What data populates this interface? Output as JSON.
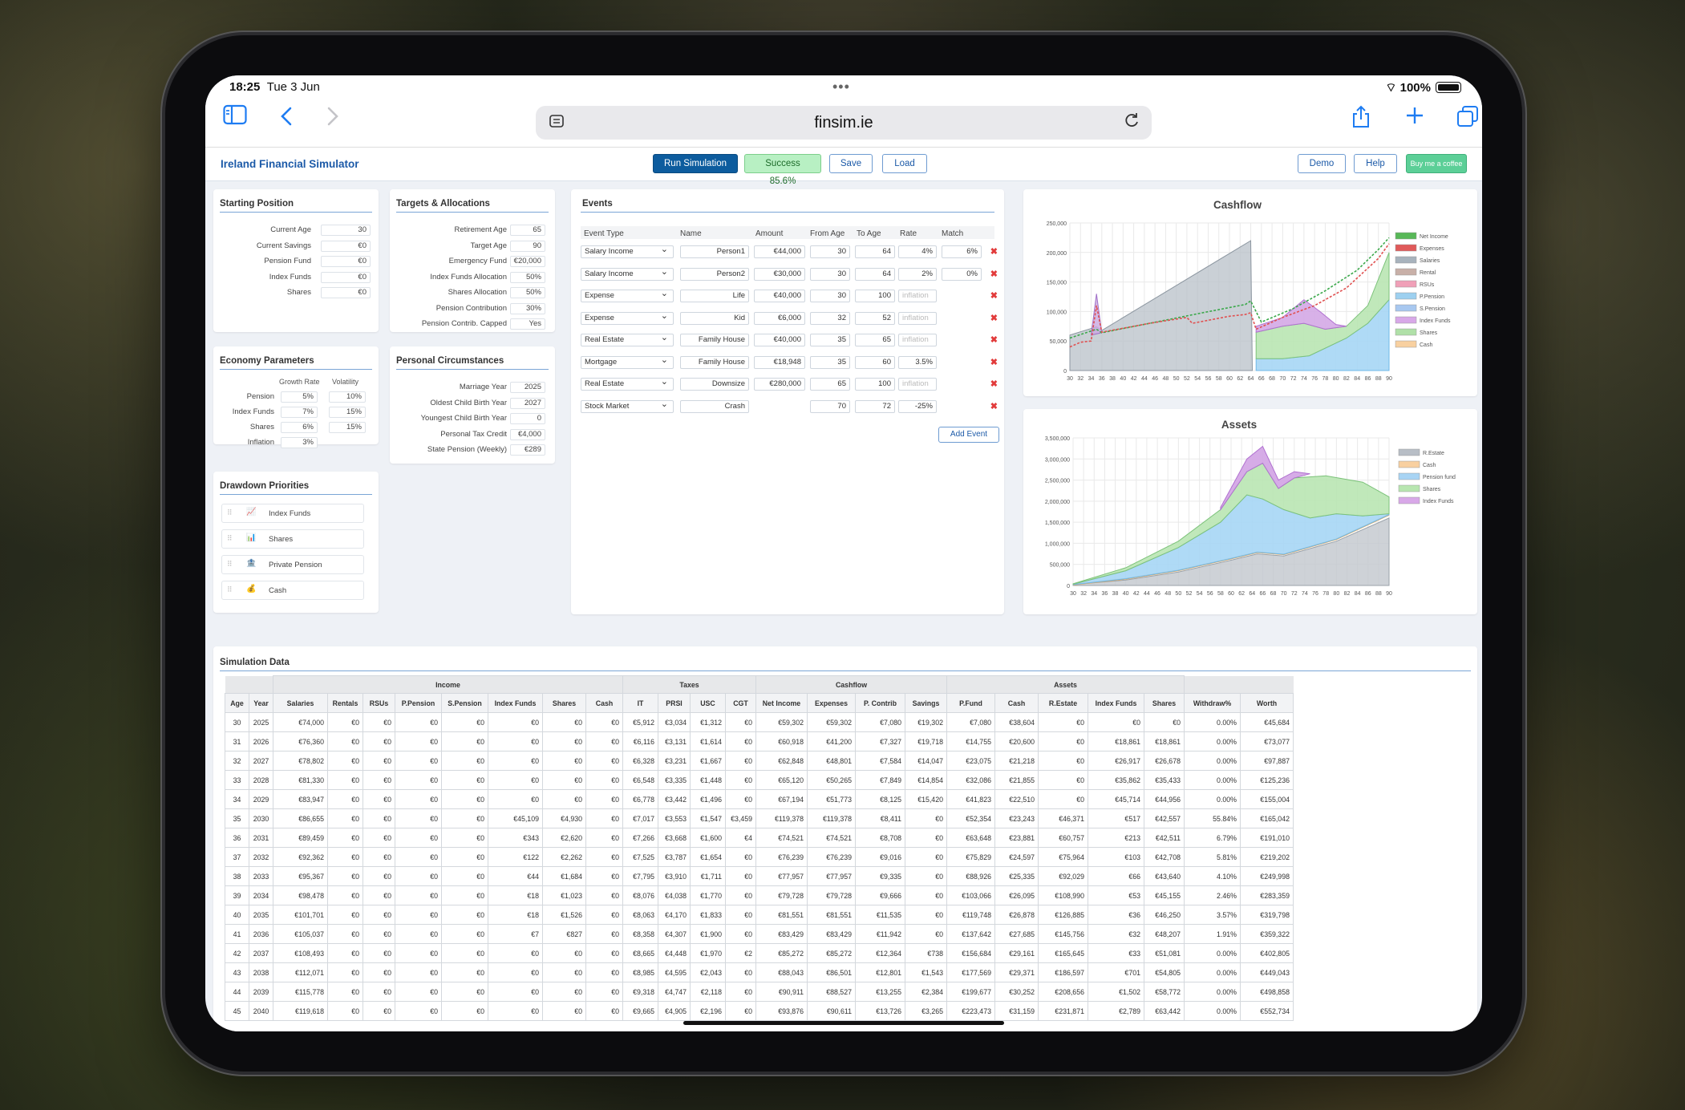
{
  "status": {
    "time": "18:25",
    "date": "Tue 3 Jun",
    "battery": "100%"
  },
  "browser": {
    "url": "finsim.ie"
  },
  "header": {
    "title": "Ireland Financial Simulator",
    "run": "Run Simulation",
    "success": "Success 85.6%",
    "save": "Save",
    "load": "Load",
    "demo": "Demo",
    "help": "Help",
    "coffee": "Buy me a coffee"
  },
  "starting": {
    "title": "Starting Position",
    "fields": [
      {
        "label": "Current Age",
        "value": "30"
      },
      {
        "label": "Current Savings",
        "value": "€0"
      },
      {
        "label": "Pension Fund",
        "value": "€0"
      },
      {
        "label": "Index Funds",
        "value": "€0"
      },
      {
        "label": "Shares",
        "value": "€0"
      }
    ]
  },
  "targets": {
    "title": "Targets & Allocations",
    "fields": [
      {
        "label": "Retirement Age",
        "value": "65"
      },
      {
        "label": "Target Age",
        "value": "90"
      },
      {
        "label": "Emergency Fund",
        "value": "€20,000"
      },
      {
        "label": "Index Funds Allocation",
        "value": "50%"
      },
      {
        "label": "Shares Allocation",
        "value": "50%"
      },
      {
        "label": "Pension Contribution",
        "value": "30%"
      },
      {
        "label": "Pension Contrib. Capped",
        "value": "Yes"
      }
    ]
  },
  "economy": {
    "title": "Economy Parameters",
    "col1": "Growth Rate",
    "col2": "Volatility",
    "rows": [
      {
        "label": "Pension",
        "growth": "5%",
        "vol": "10%"
      },
      {
        "label": "Index Funds",
        "growth": "7%",
        "vol": "15%"
      },
      {
        "label": "Shares",
        "growth": "6%",
        "vol": "15%"
      },
      {
        "label": "Inflation",
        "growth": "3%",
        "vol": ""
      }
    ]
  },
  "personal": {
    "title": "Personal Circumstances",
    "fields": [
      {
        "label": "Marriage Year",
        "value": "2025"
      },
      {
        "label": "Oldest Child Birth Year",
        "value": "2027"
      },
      {
        "label": "Youngest Child Birth Year",
        "value": "0"
      },
      {
        "label": "Personal Tax Credit",
        "value": "€4,000"
      },
      {
        "label": "State Pension (Weekly)",
        "value": "€289"
      }
    ]
  },
  "drawdown": {
    "title": "Drawdown Priorities",
    "items": [
      {
        "label": "Index Funds",
        "icon": "📈"
      },
      {
        "label": "Shares",
        "icon": "📊"
      },
      {
        "label": "Private Pension",
        "icon": "🏦"
      },
      {
        "label": "Cash",
        "icon": "💰"
      }
    ]
  },
  "events": {
    "title": "Events",
    "headers": [
      "Event Type",
      "Name",
      "Amount",
      "From Age",
      "To Age",
      "Rate",
      "Match"
    ],
    "rows": [
      {
        "type": "Salary Income",
        "name": "Person1",
        "amount": "€44,000",
        "from": "30",
        "to": "64",
        "rate": "4%",
        "match": "6%"
      },
      {
        "type": "Salary Income",
        "name": "Person2",
        "amount": "€30,000",
        "from": "30",
        "to": "64",
        "rate": "2%",
        "match": "0%"
      },
      {
        "type": "Expense",
        "name": "Life",
        "amount": "€40,000",
        "from": "30",
        "to": "100",
        "rate": "inflation",
        "match": ""
      },
      {
        "type": "Expense",
        "name": "Kid",
        "amount": "€6,000",
        "from": "32",
        "to": "52",
        "rate": "inflation",
        "match": ""
      },
      {
        "type": "Real Estate",
        "name": "Family House",
        "amount": "€40,000",
        "from": "35",
        "to": "65",
        "rate": "inflation",
        "match": ""
      },
      {
        "type": "Mortgage",
        "name": "Family House",
        "amount": "€18,948",
        "from": "35",
        "to": "60",
        "rate": "3.5%",
        "match": ""
      },
      {
        "type": "Real Estate",
        "name": "Downsize",
        "amount": "€280,000",
        "from": "65",
        "to": "100",
        "rate": "inflation",
        "match": ""
      },
      {
        "type": "Stock Market",
        "name": "Crash",
        "amount": "",
        "from": "70",
        "to": "72",
        "rate": "-25%",
        "match": ""
      }
    ],
    "add": "Add Event"
  },
  "cashflow": {
    "title": "Cashflow",
    "yticks": [
      "250,000",
      "200,000",
      "150,000",
      "100,000",
      "50,000",
      "0"
    ],
    "xticks": [
      "30",
      "32",
      "34",
      "36",
      "38",
      "40",
      "42",
      "44",
      "46",
      "48",
      "50",
      "52",
      "54",
      "56",
      "58",
      "60",
      "62",
      "64",
      "66",
      "68",
      "70",
      "72",
      "74",
      "76",
      "78",
      "80",
      "82",
      "84",
      "86",
      "88",
      "90"
    ],
    "legend": [
      "Net Income",
      "Expenses",
      "Salaries",
      "Rental",
      "RSUs",
      "P.Pension",
      "S.Pension",
      "Index Funds",
      "Shares",
      "Cash"
    ],
    "colors": [
      "#58b858",
      "#e05a5a",
      "#a8b3bd",
      "#c8b0a8",
      "#f0a0b8",
      "#9dd0f0",
      "#a8c8f0",
      "#d8a8e8",
      "#b0e0a8",
      "#f8d0a0"
    ]
  },
  "assets": {
    "title": "Assets",
    "yticks": [
      "3,500,000",
      "3,000,000",
      "2,500,000",
      "2,000,000",
      "1,500,000",
      "1,000,000",
      "500,000",
      "0"
    ],
    "legend": [
      "R.Estate",
      "Cash",
      "Pension fund",
      "Shares",
      "Index Funds"
    ],
    "colors": [
      "#b8bec6",
      "#f8d0a0",
      "#a8d4f4",
      "#b8e6b0",
      "#d8a8e8"
    ]
  },
  "sim": {
    "title": "Simulation Data",
    "groups": [
      "Income",
      "Taxes",
      "Cashflow",
      "Assets"
    ],
    "cols": [
      "Age",
      "Year",
      "Salaries",
      "Rentals",
      "RSUs",
      "P.Pension",
      "S.Pension",
      "Index Funds",
      "Shares",
      "Cash",
      "IT",
      "PRSI",
      "USC",
      "CGT",
      "Net Income",
      "Expenses",
      "P. Contrib",
      "Savings",
      "P.Fund",
      "Cash",
      "R.Estate",
      "Index Funds",
      "Shares",
      "Withdraw%",
      "Worth"
    ],
    "rows": [
      [
        "30",
        "2025",
        "€74,000",
        "€0",
        "€0",
        "€0",
        "€0",
        "€0",
        "€0",
        "€0",
        "€5,912",
        "€3,034",
        "€1,312",
        "€0",
        "€59,302",
        "€59,302",
        "€7,080",
        "€19,302",
        "€7,080",
        "€38,604",
        "€0",
        "€0",
        "€0",
        "0.00%",
        "€45,684"
      ],
      [
        "31",
        "2026",
        "€76,360",
        "€0",
        "€0",
        "€0",
        "€0",
        "€0",
        "€0",
        "€0",
        "€6,116",
        "€3,131",
        "€1,614",
        "€0",
        "€60,918",
        "€41,200",
        "€7,327",
        "€19,718",
        "€14,755",
        "€20,600",
        "€0",
        "€18,861",
        "€18,861",
        "0.00%",
        "€73,077"
      ],
      [
        "32",
        "2027",
        "€78,802",
        "€0",
        "€0",
        "€0",
        "€0",
        "€0",
        "€0",
        "€0",
        "€6,328",
        "€3,231",
        "€1,667",
        "€0",
        "€62,848",
        "€48,801",
        "€7,584",
        "€14,047",
        "€23,075",
        "€21,218",
        "€0",
        "€26,917",
        "€26,678",
        "0.00%",
        "€97,887"
      ],
      [
        "33",
        "2028",
        "€81,330",
        "€0",
        "€0",
        "€0",
        "€0",
        "€0",
        "€0",
        "€0",
        "€6,548",
        "€3,335",
        "€1,448",
        "€0",
        "€65,120",
        "€50,265",
        "€7,849",
        "€14,854",
        "€32,086",
        "€21,855",
        "€0",
        "€35,862",
        "€35,433",
        "0.00%",
        "€125,236"
      ],
      [
        "34",
        "2029",
        "€83,947",
        "€0",
        "€0",
        "€0",
        "€0",
        "€0",
        "€0",
        "€0",
        "€6,778",
        "€3,442",
        "€1,496",
        "€0",
        "€67,194",
        "€51,773",
        "€8,125",
        "€15,420",
        "€41,823",
        "€22,510",
        "€0",
        "€45,714",
        "€44,956",
        "0.00%",
        "€155,004"
      ],
      [
        "35",
        "2030",
        "€86,655",
        "€0",
        "€0",
        "€0",
        "€0",
        "€45,109",
        "€4,930",
        "€0",
        "€7,017",
        "€3,553",
        "€1,547",
        "€3,459",
        "€119,378",
        "€119,378",
        "€8,411",
        "€0",
        "€52,354",
        "€23,243",
        "€46,371",
        "€517",
        "€42,557",
        "55.84%",
        "€165,042"
      ],
      [
        "36",
        "2031",
        "€89,459",
        "€0",
        "€0",
        "€0",
        "€0",
        "€343",
        "€2,620",
        "€0",
        "€7,266",
        "€3,668",
        "€1,600",
        "€4",
        "€74,521",
        "€74,521",
        "€8,708",
        "€0",
        "€63,648",
        "€23,881",
        "€60,757",
        "€213",
        "€42,511",
        "6.79%",
        "€191,010"
      ],
      [
        "37",
        "2032",
        "€92,362",
        "€0",
        "€0",
        "€0",
        "€0",
        "€122",
        "€2,262",
        "€0",
        "€7,525",
        "€3,787",
        "€1,654",
        "€0",
        "€76,239",
        "€76,239",
        "€9,016",
        "€0",
        "€75,829",
        "€24,597",
        "€75,964",
        "€103",
        "€42,708",
        "5.81%",
        "€219,202"
      ],
      [
        "38",
        "2033",
        "€95,367",
        "€0",
        "€0",
        "€0",
        "€0",
        "€44",
        "€1,684",
        "€0",
        "€7,795",
        "€3,910",
        "€1,711",
        "€0",
        "€77,957",
        "€77,957",
        "€9,335",
        "€0",
        "€88,926",
        "€25,335",
        "€92,029",
        "€66",
        "€43,640",
        "4.10%",
        "€249,998"
      ],
      [
        "39",
        "2034",
        "€98,478",
        "€0",
        "€0",
        "€0",
        "€0",
        "€18",
        "€1,023",
        "€0",
        "€8,076",
        "€4,038",
        "€1,770",
        "€0",
        "€79,728",
        "€79,728",
        "€9,666",
        "€0",
        "€103,066",
        "€26,095",
        "€108,990",
        "€53",
        "€45,155",
        "2.46%",
        "€283,359"
      ],
      [
        "40",
        "2035",
        "€101,701",
        "€0",
        "€0",
        "€0",
        "€0",
        "€18",
        "€1,526",
        "€0",
        "€8,063",
        "€4,170",
        "€1,833",
        "€0",
        "€81,551",
        "€81,551",
        "€11,535",
        "€0",
        "€119,748",
        "€26,878",
        "€126,885",
        "€36",
        "€46,250",
        "3.57%",
        "€319,798"
      ],
      [
        "41",
        "2036",
        "€105,037",
        "€0",
        "€0",
        "€0",
        "€0",
        "€7",
        "€827",
        "€0",
        "€8,358",
        "€4,307",
        "€1,900",
        "€0",
        "€83,429",
        "€83,429",
        "€11,942",
        "€0",
        "€137,642",
        "€27,685",
        "€145,756",
        "€32",
        "€48,207",
        "1.91%",
        "€359,322"
      ],
      [
        "42",
        "2037",
        "€108,493",
        "€0",
        "€0",
        "€0",
        "€0",
        "€0",
        "€0",
        "€0",
        "€8,665",
        "€4,448",
        "€1,970",
        "€2",
        "€85,272",
        "€85,272",
        "€12,364",
        "€738",
        "€156,684",
        "€29,161",
        "€165,645",
        "€33",
        "€51,081",
        "0.00%",
        "€402,805"
      ],
      [
        "43",
        "2038",
        "€112,071",
        "€0",
        "€0",
        "€0",
        "€0",
        "€0",
        "€0",
        "€0",
        "€8,985",
        "€4,595",
        "€2,043",
        "€0",
        "€88,043",
        "€86,501",
        "€12,801",
        "€1,543",
        "€177,569",
        "€29,371",
        "€186,597",
        "€701",
        "€54,805",
        "0.00%",
        "€449,043"
      ],
      [
        "44",
        "2039",
        "€115,778",
        "€0",
        "€0",
        "€0",
        "€0",
        "€0",
        "€0",
        "€0",
        "€9,318",
        "€4,747",
        "€2,118",
        "€0",
        "€90,911",
        "€88,527",
        "€13,255",
        "€2,384",
        "€199,677",
        "€30,252",
        "€208,656",
        "€1,502",
        "€58,772",
        "0.00%",
        "€498,858"
      ],
      [
        "45",
        "2040",
        "€119,618",
        "€0",
        "€0",
        "€0",
        "€0",
        "€0",
        "€0",
        "€0",
        "€9,665",
        "€4,905",
        "€2,196",
        "€0",
        "€93,876",
        "€90,611",
        "€13,726",
        "€3,265",
        "€223,473",
        "€31,159",
        "€231,871",
        "€2,789",
        "€63,442",
        "0.00%",
        "€552,734"
      ]
    ]
  }
}
